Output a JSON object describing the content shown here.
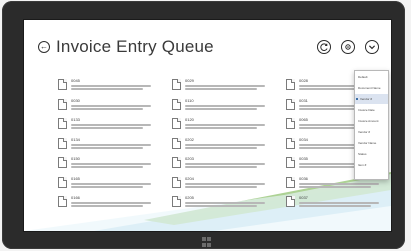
{
  "header": {
    "back_glyph": "←",
    "title": "Invoice Entry Queue",
    "icons": [
      "refresh-icon",
      "settings-icon",
      "menu-icon"
    ]
  },
  "tiles": [
    {
      "code": "0045"
    },
    {
      "code": "0029"
    },
    {
      "code": "0028"
    },
    {
      "code": "0030"
    },
    {
      "code": "0110"
    },
    {
      "code": "0031"
    },
    {
      "code": "0133"
    },
    {
      "code": "0120"
    },
    {
      "code": "0065"
    },
    {
      "code": "0134"
    },
    {
      "code": "0202"
    },
    {
      "code": "0034"
    },
    {
      "code": "0150"
    },
    {
      "code": "0203"
    },
    {
      "code": "0035"
    },
    {
      "code": "0165"
    },
    {
      "code": "0204"
    },
    {
      "code": "0036"
    },
    {
      "code": "0166"
    },
    {
      "code": "0205"
    },
    {
      "code": "0037"
    }
  ],
  "menu": {
    "items": [
      {
        "label": "Default"
      },
      {
        "label": "Document Name"
      },
      {
        "label": "Vendor #"
      },
      {
        "label": "Invoice Date"
      },
      {
        "label": "Invoice Amount"
      },
      {
        "label": "Vendor #"
      },
      {
        "label": "Vendor Name"
      },
      {
        "label": "Status"
      },
      {
        "label": "Item #"
      }
    ],
    "selected_index": 2
  },
  "colors": {
    "swoosh_green": "#a9d08e",
    "swoosh_blue": "#bfe0f0",
    "menu_selected": "#dbe3f0",
    "menu_bullet": "#3b6ea5"
  }
}
